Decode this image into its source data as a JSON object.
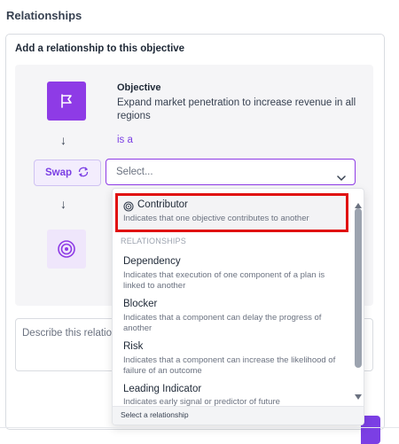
{
  "section_title": "Relationships",
  "panel": {
    "title": "Add a relationship to this objective",
    "source": {
      "label": "Objective",
      "value": "Expand market penetration to increase revenue in all regions"
    },
    "relation_prefix": "is a",
    "swap_label": "Swap",
    "select": {
      "placeholder": "Select..."
    },
    "description": {
      "placeholder": "Describe this relatio"
    }
  },
  "dropdown": {
    "highlighted": {
      "label": "Contributor",
      "desc": "Indicates that one objective contributes to another"
    },
    "group_label": "RELATIONSHIPS",
    "options": [
      {
        "label": "Dependency",
        "desc": "Indicates that execution of one component of a plan is linked to another"
      },
      {
        "label": "Blocker",
        "desc": "Indicates that a component can delay the progress of another"
      },
      {
        "label": "Risk",
        "desc": "Indicates that a component can increase the likelihood of failure of an outcome"
      },
      {
        "label": "Leading Indicator",
        "desc": "Indicates early signal or predictor of future"
      }
    ],
    "footer": "Select a relationship"
  },
  "colors": {
    "accent": "#7b3fe4",
    "icon_bg": "#8e3be6",
    "highlight_border": "#e01010"
  }
}
